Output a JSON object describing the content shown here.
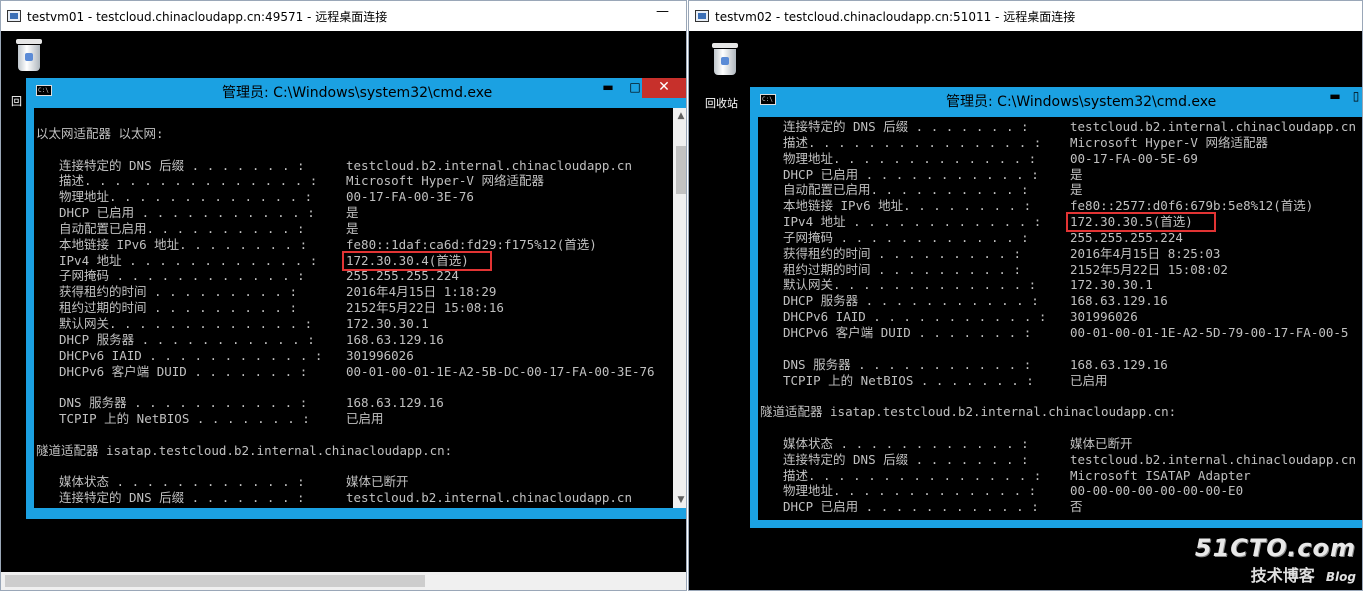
{
  "left_window": {
    "title": "testvm01 - testcloud.chinacloudapp.cn:49571 - 远程桌面连接",
    "minimize_label": "—",
    "recycle_bin_label": "回",
    "cmd": {
      "title": "管理员: C:\\Windows\\system32\\cmd.exe",
      "icon_label": "C:\\",
      "min_label": "▬",
      "max_label": "□",
      "close_label": "✕",
      "lines": [
        {
          "indent": 0,
          "label": "",
          "value": ""
        },
        {
          "indent": 0,
          "label": "以太网适配器 以太网:",
          "value": ""
        },
        {
          "indent": 0,
          "label": "",
          "value": ""
        },
        {
          "indent": 1,
          "label": "连接特定的 DNS 后缀 . . . . . . . :",
          "value": "testcloud.b2.internal.chinacloudapp.cn"
        },
        {
          "indent": 1,
          "label": "描述. . . . . . . . . . . . . . . :",
          "value": "Microsoft Hyper-V 网络适配器"
        },
        {
          "indent": 1,
          "label": "物理地址. . . . . . . . . . . . . :",
          "value": "00-17-FA-00-3E-76"
        },
        {
          "indent": 1,
          "label": "DHCP 已启用 . . . . . . . . . . . :",
          "value": "是"
        },
        {
          "indent": 1,
          "label": "自动配置已启用. . . . . . . . . . :",
          "value": "是"
        },
        {
          "indent": 1,
          "label": "本地链接 IPv6 地址. . . . . . . . :",
          "value": "fe80::1daf:ca6d:fd29:f175%12(首选)"
        },
        {
          "indent": 1,
          "label": "IPv4 地址 . . . . . . . . . . . . :",
          "value": "172.30.30.4(首选)"
        },
        {
          "indent": 1,
          "label": "子网掩码 . . . . . . . . . . . . :",
          "value": "255.255.255.224"
        },
        {
          "indent": 1,
          "label": "获得租约的时间 . . . . . . . . . :",
          "value": "2016年4月15日 1:18:29"
        },
        {
          "indent": 1,
          "label": "租约过期的时间 . . . . . . . . . :",
          "value": "2152年5月22日 15:08:16"
        },
        {
          "indent": 1,
          "label": "默认网关. . . . . . . . . . . . . :",
          "value": "172.30.30.1"
        },
        {
          "indent": 1,
          "label": "DHCP 服务器 . . . . . . . . . . . :",
          "value": "168.63.129.16"
        },
        {
          "indent": 1,
          "label": "DHCPv6 IAID . . . . . . . . . . . :",
          "value": "301996026"
        },
        {
          "indent": 1,
          "label": "DHCPv6 客户端 DUID . . . . . . . :",
          "value": "00-01-00-01-1E-A2-5B-DC-00-17-FA-00-3E-76"
        },
        {
          "indent": 0,
          "label": "",
          "value": ""
        },
        {
          "indent": 1,
          "label": "DNS 服务器 . . . . . . . . . . . :",
          "value": "168.63.129.16"
        },
        {
          "indent": 1,
          "label": "TCPIP 上的 NetBIOS . . . . . . . :",
          "value": "已启用"
        },
        {
          "indent": 0,
          "label": "",
          "value": ""
        },
        {
          "indent": 0,
          "label": "隧道适配器 isatap.testcloud.b2.internal.chinacloudapp.cn:",
          "value": ""
        },
        {
          "indent": 0,
          "label": "",
          "value": ""
        },
        {
          "indent": 1,
          "label": "媒体状态 . . . . . . . . . . . . :",
          "value": "媒体已断开"
        },
        {
          "indent": 1,
          "label": "连接特定的 DNS 后缀 . . . . . . . :",
          "value": "testcloud.b2.internal.chinacloudapp.cn"
        }
      ]
    }
  },
  "right_window": {
    "title": "testvm02 - testcloud.chinacloudapp.cn:51011 - 远程桌面连接",
    "recycle_bin_label": "回收站",
    "cmd": {
      "title": "管理员: C:\\Windows\\system32\\cmd.exe",
      "icon_label": "C:\\",
      "min_label": "▬",
      "lines": [
        {
          "indent": 1,
          "label": "连接特定的 DNS 后缀 . . . . . . . :",
          "value": "testcloud.b2.internal.chinacloudapp.cn"
        },
        {
          "indent": 1,
          "label": "描述. . . . . . . . . . . . . . . :",
          "value": "Microsoft Hyper-V 网络适配器"
        },
        {
          "indent": 1,
          "label": "物理地址. . . . . . . . . . . . . :",
          "value": "00-17-FA-00-5E-69"
        },
        {
          "indent": 1,
          "label": "DHCP 已启用 . . . . . . . . . . . :",
          "value": "是"
        },
        {
          "indent": 1,
          "label": "自动配置已启用. . . . . . . . . . :",
          "value": "是"
        },
        {
          "indent": 1,
          "label": "本地链接 IPv6 地址. . . . . . . . :",
          "value": "fe80::2577:d0f6:679b:5e8%12(首选)"
        },
        {
          "indent": 1,
          "label": "IPv4 地址 . . . . . . . . . . . . :",
          "value": "172.30.30.5(首选)"
        },
        {
          "indent": 1,
          "label": "子网掩码 . . . . . . . . . . . . :",
          "value": "255.255.255.224"
        },
        {
          "indent": 1,
          "label": "获得租约的时间 . . . . . . . . . :",
          "value": "2016年4月15日 8:25:03"
        },
        {
          "indent": 1,
          "label": "租约过期的时间 . . . . . . . . . :",
          "value": "2152年5月22日 15:08:02"
        },
        {
          "indent": 1,
          "label": "默认网关. . . . . . . . . . . . . :",
          "value": "172.30.30.1"
        },
        {
          "indent": 1,
          "label": "DHCP 服务器 . . . . . . . . . . . :",
          "value": "168.63.129.16"
        },
        {
          "indent": 1,
          "label": "DHCPv6 IAID . . . . . . . . . . . :",
          "value": "301996026"
        },
        {
          "indent": 1,
          "label": "DHCPv6 客户端 DUID . . . . . . . :",
          "value": "00-01-00-01-1E-A2-5D-79-00-17-FA-00-5"
        },
        {
          "indent": 0,
          "label": "",
          "value": ""
        },
        {
          "indent": 1,
          "label": "DNS 服务器 . . . . . . . . . . . :",
          "value": "168.63.129.16"
        },
        {
          "indent": 1,
          "label": "TCPIP 上的 NetBIOS . . . . . . . :",
          "value": "已启用"
        },
        {
          "indent": 0,
          "label": "",
          "value": ""
        },
        {
          "indent": 0,
          "label": "隧道适配器 isatap.testcloud.b2.internal.chinacloudapp.cn:",
          "value": ""
        },
        {
          "indent": 0,
          "label": "",
          "value": ""
        },
        {
          "indent": 1,
          "label": "媒体状态 . . . . . . . . . . . . :",
          "value": "媒体已断开"
        },
        {
          "indent": 1,
          "label": "连接特定的 DNS 后缀 . . . . . . . :",
          "value": "testcloud.b2.internal.chinacloudapp.cn"
        },
        {
          "indent": 1,
          "label": "描述. . . . . . . . . . . . . . . :",
          "value": "Microsoft ISATAP Adapter"
        },
        {
          "indent": 1,
          "label": "物理地址. . . . . . . . . . . . . :",
          "value": "00-00-00-00-00-00-00-E0"
        },
        {
          "indent": 1,
          "label": "DHCP 已启用 . . . . . . . . . . . :",
          "value": "否"
        }
      ]
    }
  },
  "watermark": {
    "main": "51CTO.com",
    "sub": "技术博客",
    "blog": "Blog"
  },
  "colors": {
    "cmd_frame": "#1ba1e2",
    "console_text": "#c0c0c0",
    "highlight": "#e23434"
  }
}
